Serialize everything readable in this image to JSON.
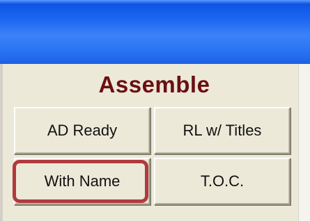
{
  "panel": {
    "title": "Assemble"
  },
  "buttons": {
    "ad_ready": "AD Ready",
    "rl_with_titles": "RL w/ Titles",
    "with_name": "With Name",
    "toc": "T.O.C."
  },
  "colors": {
    "titlebar": "#2a74f2",
    "panel_background": "#ece9d8",
    "heading_text": "#6b0f12",
    "highlight_outline": "#b03a3f"
  }
}
